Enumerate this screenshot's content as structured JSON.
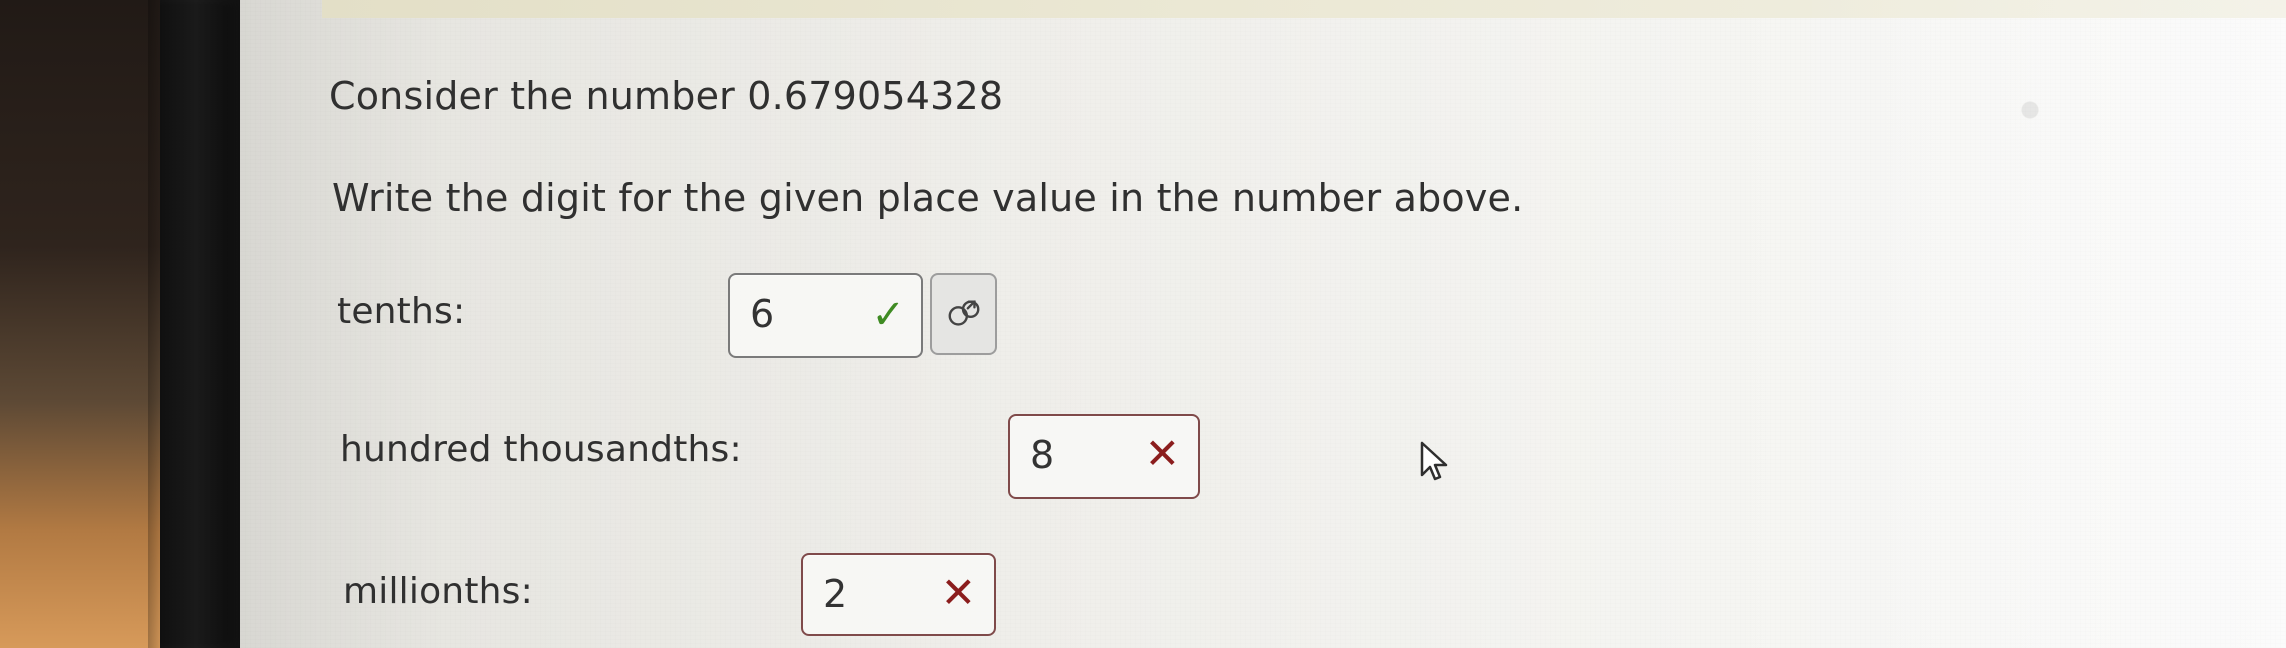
{
  "question": {
    "prompt": "Consider the number 0.679054328",
    "instructions": "Write the digit for the given place value in the number above."
  },
  "rows": [
    {
      "label": "tenths:",
      "answer": "6",
      "status": "correct",
      "status_icon": "check-icon"
    },
    {
      "label": "hundred thousandths:",
      "answer": "8",
      "status": "incorrect",
      "status_icon": "x-icon"
    },
    {
      "label": "millionths:",
      "answer": "2",
      "status": "incorrect",
      "status_icon": "x-icon"
    }
  ],
  "icons": {
    "hint_button": "hint-icon",
    "cursor": "mouse-pointer-icon"
  },
  "colors": {
    "correct": "#3f8b23",
    "incorrect": "#8b1d1d"
  }
}
